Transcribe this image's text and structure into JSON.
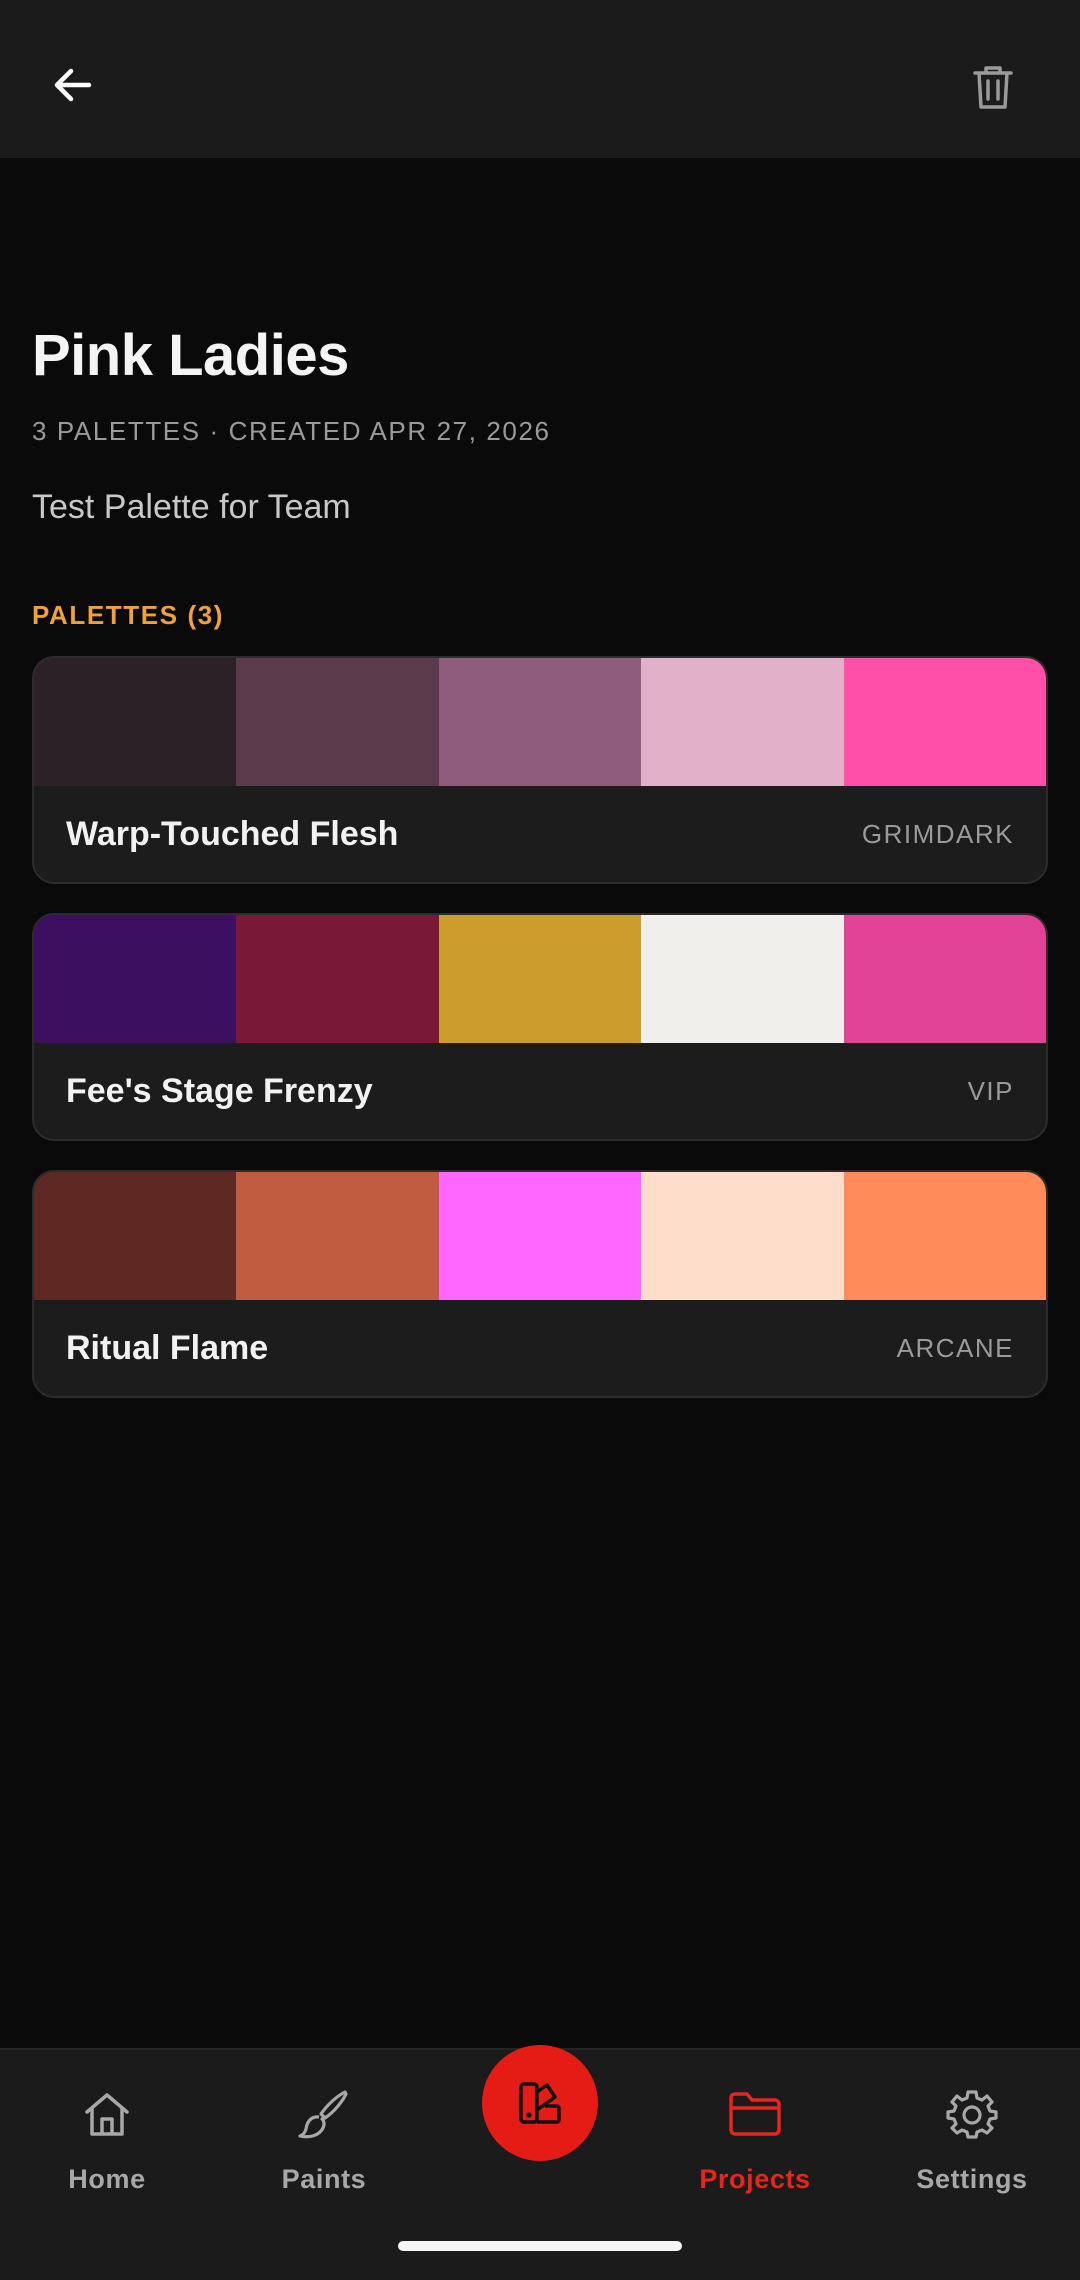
{
  "header": {
    "back_icon": "arrow-left-icon",
    "delete_icon": "trash-icon"
  },
  "project": {
    "title": "Pink Ladies",
    "meta": "3 PALETTES · CREATED APR 27, 2026",
    "description": "Test Palette for Team",
    "palettes_label": "PALETTES (3)"
  },
  "palettes": [
    {
      "name": "Warp-Touched Flesh",
      "tag": "GRIMDARK",
      "colors": [
        "#2c2127",
        "#5b3a4c",
        "#8f5b7b",
        "#e2b0c8",
        "#ff4fa8"
      ]
    },
    {
      "name": "Fee's Stage Frenzy",
      "tag": "VIP",
      "colors": [
        "#3c0f61",
        "#7a1838",
        "#cc9c2c",
        "#f0efec",
        "#e14397"
      ]
    },
    {
      "name": "Ritual Flame",
      "tag": "ARCANE",
      "colors": [
        "#5e2922",
        "#c05c40",
        "#ff66ff",
        "#ffddcb",
        "#ff8b5a"
      ]
    }
  ],
  "nav": {
    "items": [
      {
        "label": "Home",
        "icon": "home-icon",
        "active": false
      },
      {
        "label": "Paints",
        "icon": "brush-icon",
        "active": false
      },
      {
        "label": "Projects",
        "icon": "folder-icon",
        "active": true
      },
      {
        "label": "Settings",
        "icon": "gear-icon",
        "active": false
      }
    ],
    "fab_icon": "palette-swatch-icon"
  },
  "colors": {
    "accent": "#e51b16",
    "section_label": "#f0a13a",
    "background": "#0a0a0a",
    "surface": "#1b1b1b"
  }
}
